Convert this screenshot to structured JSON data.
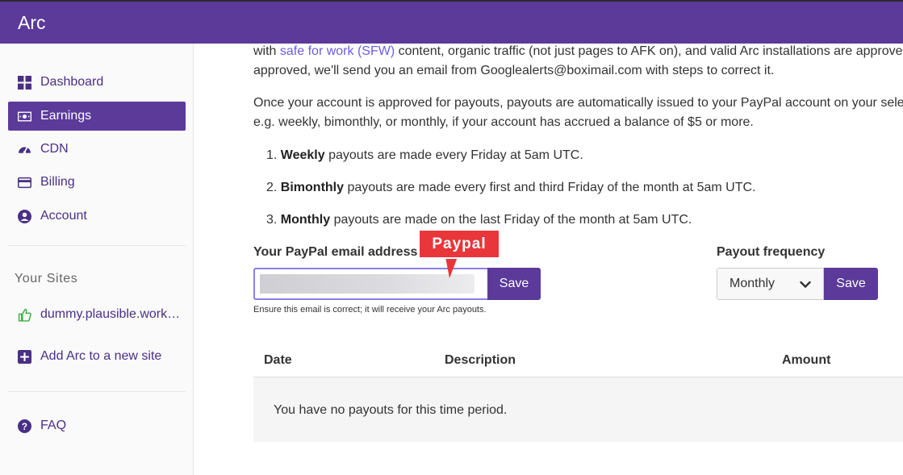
{
  "app": {
    "title": "Arc"
  },
  "sidebar": {
    "items": [
      {
        "label": "Dashboard",
        "icon": "dashboard-icon"
      },
      {
        "label": "Earnings",
        "icon": "money-icon",
        "active": true
      },
      {
        "label": "CDN",
        "icon": "speedometer-icon"
      },
      {
        "label": "Billing",
        "icon": "credit-card-icon"
      },
      {
        "label": "Account",
        "icon": "user-circle-icon"
      }
    ],
    "sites_title": "Your Sites",
    "sites": [
      {
        "label": "dummy.plausible.work…",
        "icon": "thumbs-up-icon"
      }
    ],
    "add_site_label": "Add Arc to a new site",
    "faq_label": "FAQ"
  },
  "content": {
    "p1_line1_pre": "with ",
    "p1_link": "safe for work (SFW)",
    "p1_line1_post": " content, organic traffic (not just pages to AFK on), and valid Arc installations are approve",
    "p1_line2": "approved, we'll send you an email from Googlealerts@boximail.com with steps to correct it.",
    "p2_line1": "Once your account is approved for payouts, payouts are automatically issued to your PayPal account on your selec",
    "p2_line2": "e.g. weekly, bimonthly, or monthly, if your account has accrued a balance of $5 or more.",
    "list": [
      {
        "num": "1.",
        "bold": "Weekly",
        "text": " payouts are made every Friday at 5am UTC."
      },
      {
        "num": "2.",
        "bold": "Bimonthly",
        "text": " payouts are made every first and third Friday of the month at 5am UTC."
      },
      {
        "num": "3.",
        "bold": "Monthly",
        "text": " payouts are made on the last Friday of the month at 5am UTC."
      }
    ]
  },
  "paypal": {
    "label": "Your PayPal email address:",
    "value": "",
    "save_label": "Save",
    "hint": "Ensure this email is correct; it will receive your Arc payouts."
  },
  "frequency": {
    "label": "Payout frequency",
    "selected": "Monthly",
    "save_label": "Save"
  },
  "callout": {
    "text": "Paypal"
  },
  "table": {
    "headers": [
      "Date",
      "Description",
      "Amount"
    ],
    "empty_message": "You have no payouts for this time period."
  },
  "colors": {
    "brand": "#5b3a9a",
    "link": "#6a5de6",
    "callout": "#e8363a",
    "success": "#3fae49"
  }
}
